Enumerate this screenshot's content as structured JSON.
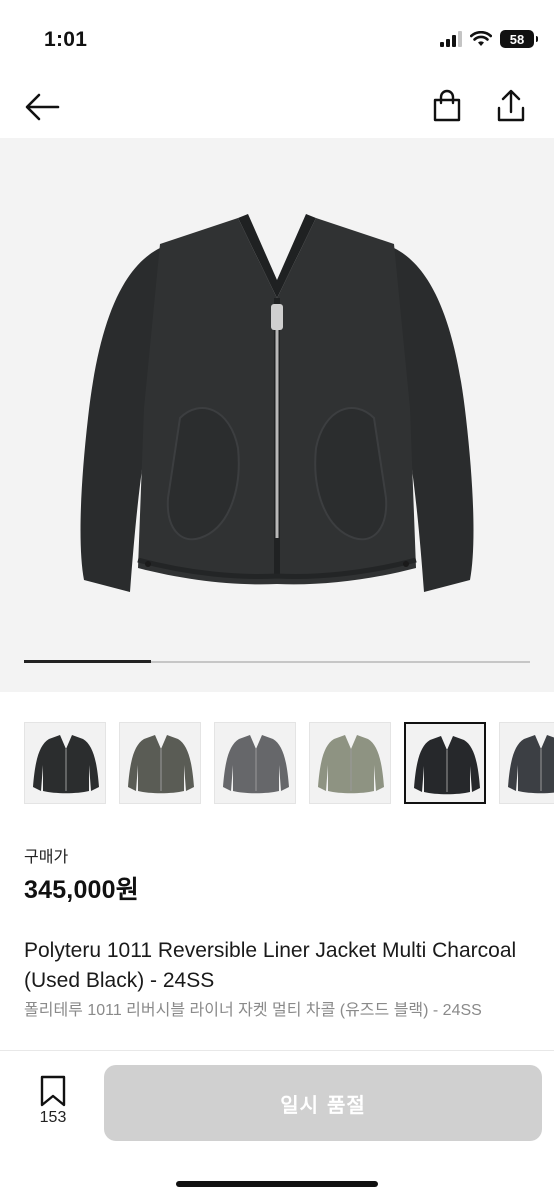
{
  "status_bar": {
    "time": "1:01",
    "battery": "58"
  },
  "nav": {
    "back_icon": "arrow-left-icon",
    "cart_icon": "shopping-bag-icon",
    "share_icon": "share-icon"
  },
  "gallery": {
    "main_image": "black reversible liner jacket with zip front",
    "progress": 0.25,
    "thumbnails": [
      {
        "label": "black jacket",
        "color": "#2b2d2e",
        "selected": false
      },
      {
        "label": "dark olive jacket",
        "color": "#5a5c55",
        "selected": false
      },
      {
        "label": "charcoal grey jacket",
        "color": "#66676a",
        "selected": false
      },
      {
        "label": "light olive jacket",
        "color": "#8e9382",
        "selected": false
      },
      {
        "label": "used black jacket",
        "color": "#26282b",
        "selected": true
      },
      {
        "label": "charcoal jacket",
        "color": "#3c3f44",
        "selected": false
      }
    ]
  },
  "product": {
    "price_label": "구매가",
    "price": "345,000원",
    "title_en": "Polyteru 1011 Reversible Liner Jacket Multi Charcoal (Used Black) - 24SS",
    "title_ko": "폴리테루 1011 리버시블 라이너 자켓 멀티 차콜 (유즈드 블랙) - 24SS"
  },
  "bottom": {
    "wish_count": "153",
    "button_label": "일시 품절"
  },
  "colors": {
    "button_disabled": "#d0d0d0",
    "hero_bg": "#f3f3f3",
    "text": "#111111",
    "muted": "#8a8a8a"
  }
}
